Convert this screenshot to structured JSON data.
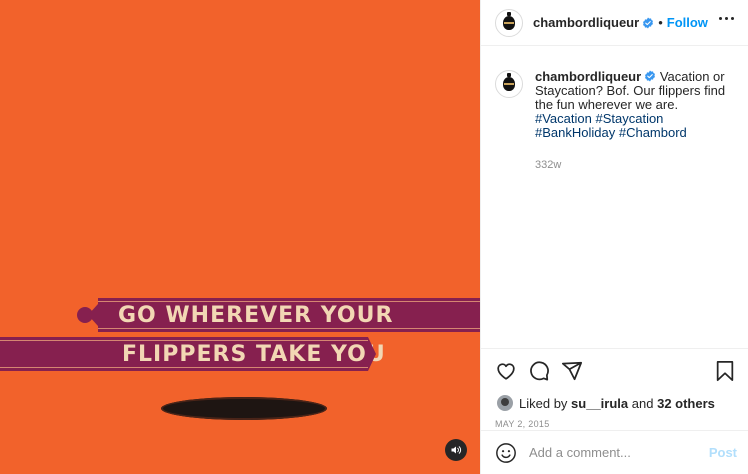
{
  "media": {
    "banner_line1": "GO WHEREVER YOUR",
    "banner_line2": "FLIPPERS TAKE YOU",
    "background_color": "#f2622b",
    "banner_color": "#86204f",
    "sound_icon": "speaker-icon"
  },
  "header": {
    "username": "chambordliqueur",
    "separator": "•",
    "follow_label": "Follow",
    "more_icon": "more-options-icon"
  },
  "caption": {
    "username": "chambordliqueur",
    "text": "Vacation or Staycation? Bof. Our flippers find the fun wherever we are.",
    "hashtags": [
      "#Vacation",
      "#Staycation",
      "#BankHoliday",
      "#Chambord"
    ],
    "age": "332w"
  },
  "actions": {
    "icons": [
      "heart-icon",
      "comment-icon",
      "share-icon",
      "bookmark-icon"
    ],
    "liked_by_prefix": "Liked by",
    "liked_by_user": "su__irula",
    "liked_by_and": "and",
    "liked_by_others": "32 others",
    "date": "MAY 2, 2015"
  },
  "comment": {
    "placeholder": "Add a comment...",
    "post_label": "Post"
  },
  "colors": {
    "accent": "#0095f6",
    "hashtag": "#00376b",
    "muted": "#8e8e8e"
  }
}
